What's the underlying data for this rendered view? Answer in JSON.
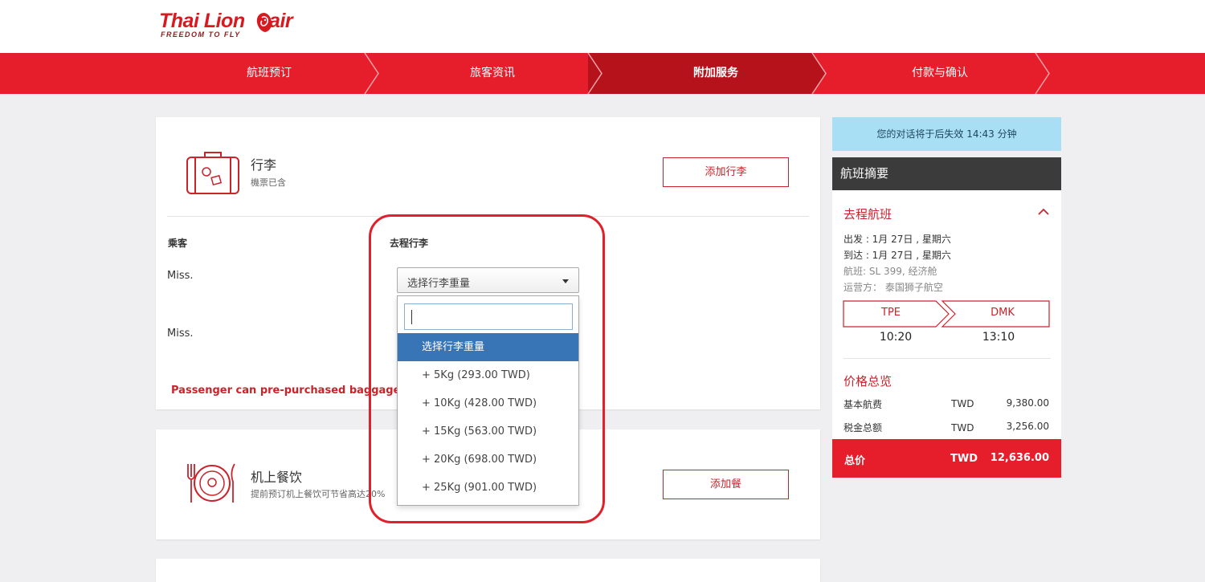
{
  "brand": {
    "name": "Thai Lion air",
    "tagline": "FREEDOM TO FLY",
    "accent_color": "#e61d2a"
  },
  "steps": [
    {
      "label": "航班预订",
      "active": false
    },
    {
      "label": "旅客资讯",
      "active": false
    },
    {
      "label": "附加服务",
      "active": true
    },
    {
      "label": "付款与确认",
      "active": false
    }
  ],
  "baggage": {
    "icon": "suitcase-icon",
    "title": "行李",
    "subtitle": "機票已含",
    "add_button": "添加行李",
    "passenger_header": "乘客",
    "outbound_header": "去程行李",
    "passengers": [
      "Miss.",
      "Miss."
    ],
    "select_placeholder": "选择行李重量",
    "warning": "Passenger can pre-purchased baggage no",
    "search_value": "",
    "options": [
      {
        "label": "选择行李重量",
        "selected": true
      },
      {
        "label": "+ 5Kg (293.00 TWD)",
        "selected": false
      },
      {
        "label": "+ 10Kg (428.00 TWD)",
        "selected": false
      },
      {
        "label": "+ 15Kg (563.00 TWD)",
        "selected": false
      },
      {
        "label": "+ 20Kg (698.00 TWD)",
        "selected": false
      },
      {
        "label": "+ 25Kg (901.00 TWD)",
        "selected": false
      }
    ]
  },
  "meal": {
    "icon": "meal-plate-icon",
    "title": "机上餐饮",
    "subtitle": "提前预订机上餐饮可节省高达20%",
    "add_button": "添加餐"
  },
  "sidebar": {
    "session_notice": "您的对话将于后失效 14:43 分钟",
    "summary_title": "航班摘要",
    "outbound_title": "去程航班",
    "depart": "出发 : 1月 27日 , 星期六",
    "arrive": "到达 : 1月 27日 , 星期六",
    "flight": "航班: SL 399, 经济舱",
    "operator": "运营方： 泰国狮子航空",
    "origin": "TPE",
    "destination": "DMK",
    "depart_time": "10:20",
    "arrive_time": "13:10",
    "price_title": "价格总览",
    "prices": [
      {
        "label": "基本航费",
        "currency": "TWD",
        "amount": "9,380.00"
      },
      {
        "label": "税金总额",
        "currency": "TWD",
        "amount": "3,256.00"
      }
    ],
    "total": {
      "label": "总价",
      "currency": "TWD",
      "amount": "12,636.00"
    }
  }
}
